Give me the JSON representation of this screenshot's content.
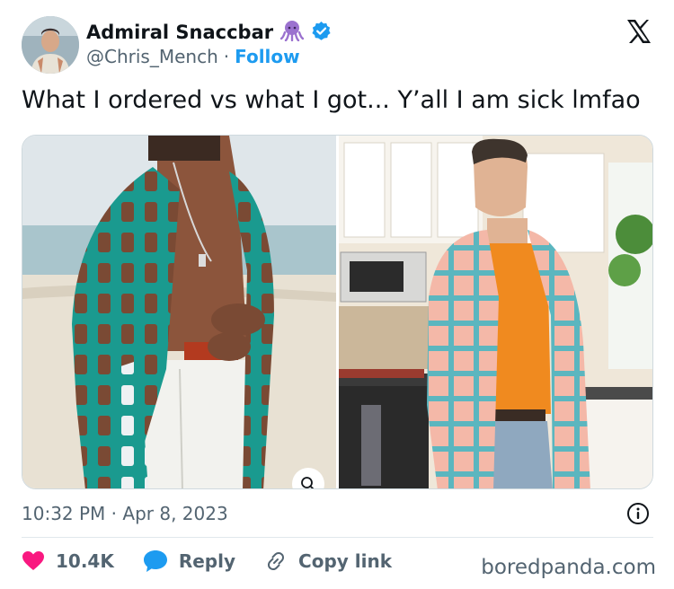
{
  "header": {
    "display_name": "Admiral Snaccbar",
    "handle": "@Chris_Mench",
    "separator": "·",
    "follow_label": "Follow"
  },
  "tweet": {
    "text": "What I ordered vs what I got... Y’all I am sick lmfao",
    "timestamp": "10:32 PM · Apr 8, 2023"
  },
  "actions": {
    "like_count": "10.4K",
    "reply_label": "Reply",
    "copy_link_label": "Copy link"
  },
  "watermark": "boredpanda.com",
  "colors": {
    "accent": "#1d9bf0",
    "like": "#f91880",
    "text": "#0f1419",
    "muted": "#536471"
  },
  "icons": {
    "emoji": "octopus-icon",
    "verified": "verified-badge-icon",
    "brand": "x-logo-icon",
    "zoom": "magnifier-icon",
    "info": "info-icon",
    "like": "heart-icon",
    "reply": "speech-bubble-icon",
    "copy": "link-icon"
  }
}
